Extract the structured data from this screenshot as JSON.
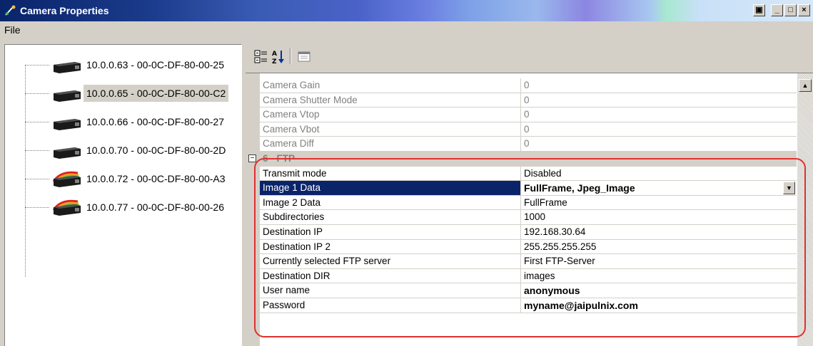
{
  "window": {
    "title": "Camera Properties",
    "buttons": [
      "▣",
      "_",
      "□",
      "×"
    ]
  },
  "menu": {
    "file": "File"
  },
  "tree": {
    "items": [
      {
        "label": "10.0.0.63 - 00-0C-DF-80-00-25",
        "icon": "camera-icon"
      },
      {
        "label": "10.0.0.65 - 00-0C-DF-80-00-C2",
        "icon": "camera-icon",
        "selected": true
      },
      {
        "label": "10.0.0.66 - 00-0C-DF-80-00-27",
        "icon": "camera-icon"
      },
      {
        "label": "10.0.0.70 - 00-0C-DF-80-00-2D",
        "icon": "camera-icon"
      },
      {
        "label": "10.0.0.72 - 00-0C-DF-80-00-A3",
        "icon": "rainbow-camera-icon"
      },
      {
        "label": "10.0.0.77 - 00-0C-DF-80-00-26",
        "icon": "rainbow-camera-icon"
      }
    ]
  },
  "toolbar": {
    "categorized_icon": "categorized-icon",
    "alphabetical_icon": "alphabetical-sort-icon",
    "property_pages_icon": "property-pages-icon"
  },
  "grid": {
    "disabled_rows": [
      {
        "name": "Camera Gain",
        "value": "0"
      },
      {
        "name": "Camera Shutter Mode",
        "value": "0"
      },
      {
        "name": "Camera Vtop",
        "value": "0"
      },
      {
        "name": "Camera Vbot",
        "value": "0"
      },
      {
        "name": "Camera Diff",
        "value": "0"
      }
    ],
    "category": {
      "label": "6 - FTP",
      "expander": "⊟"
    },
    "ftp_rows": [
      {
        "name": "Transmit mode",
        "value": "Disabled"
      },
      {
        "name": "Image 1 Data",
        "value": "FullFrame, Jpeg_Image",
        "selected": true,
        "bold": true,
        "dropdown": "▼"
      },
      {
        "name": "Image 2 Data",
        "value": "FullFrame"
      },
      {
        "name": "Subdirectories",
        "value": "1000"
      },
      {
        "name": "Destination IP",
        "value": "192.168.30.64"
      },
      {
        "name": "Destination IP 2",
        "value": "255.255.255.255"
      },
      {
        "name": "Currently selected FTP server",
        "value": "First FTP-Server"
      },
      {
        "name": "Destination DIR",
        "value": "images"
      },
      {
        "name": "User name",
        "value": "anonymous",
        "bold": true
      },
      {
        "name": "Password",
        "value": "myname@jaipulnix.com",
        "bold": true
      }
    ],
    "scroll_up": "▲"
  },
  "colors": {
    "selection": "#0a246a",
    "highlight_outline": "#e03030",
    "face": "#d4d0c8"
  }
}
